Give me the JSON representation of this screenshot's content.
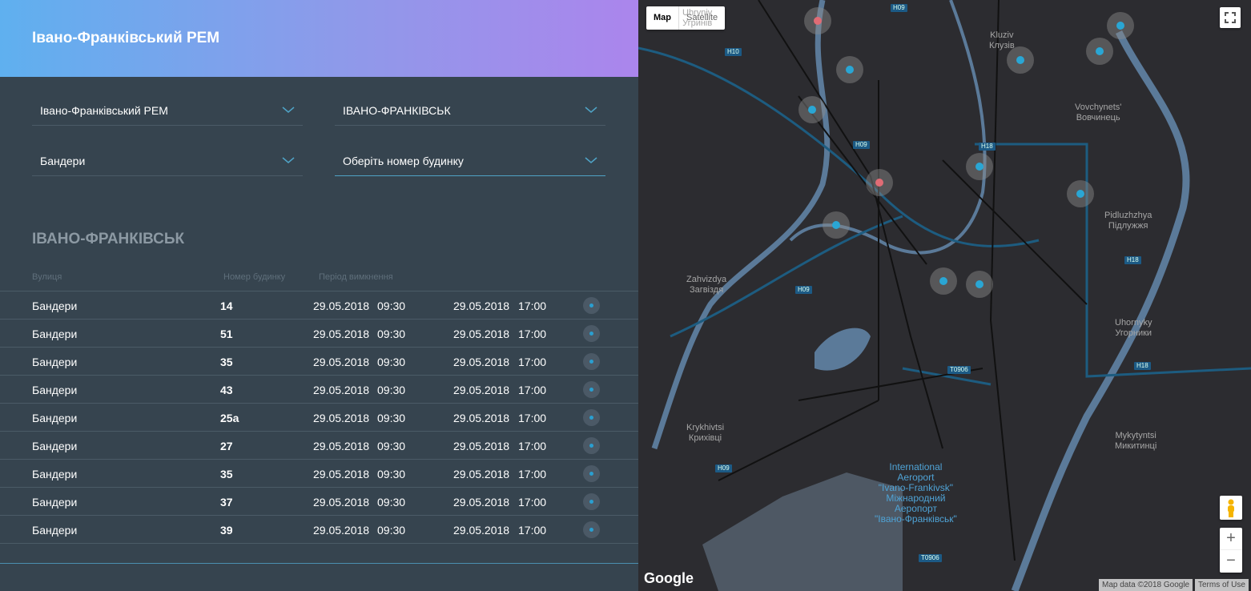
{
  "header": {
    "title": "Івано-Франківський РЕМ"
  },
  "filters": {
    "rem": "Івано-Франківський РЕМ",
    "city": "ІВАНО-ФРАНКІВСЬК",
    "street": "Бандери",
    "house_placeholder": "Оберіть номер будинку"
  },
  "results": {
    "city": "ІВАНО-ФРАНКІВСЬК",
    "columns": [
      "Вулиця",
      "Номер будинку",
      "Період вимкнення"
    ],
    "rows": [
      {
        "street": "Бандери",
        "house": "14",
        "start_date": "29.05.2018",
        "start_time": "09:30",
        "end_date": "29.05.2018",
        "end_time": "17:00"
      },
      {
        "street": "Бандери",
        "house": "51",
        "start_date": "29.05.2018",
        "start_time": "09:30",
        "end_date": "29.05.2018",
        "end_time": "17:00"
      },
      {
        "street": "Бандери",
        "house": "35",
        "start_date": "29.05.2018",
        "start_time": "09:30",
        "end_date": "29.05.2018",
        "end_time": "17:00"
      },
      {
        "street": "Бандери",
        "house": "43",
        "start_date": "29.05.2018",
        "start_time": "09:30",
        "end_date": "29.05.2018",
        "end_time": "17:00"
      },
      {
        "street": "Бандери",
        "house": "25а",
        "start_date": "29.05.2018",
        "start_time": "09:30",
        "end_date": "29.05.2018",
        "end_time": "17:00"
      },
      {
        "street": "Бандери",
        "house": "27",
        "start_date": "29.05.2018",
        "start_time": "09:30",
        "end_date": "29.05.2018",
        "end_time": "17:00"
      },
      {
        "street": "Бандери",
        "house": "35",
        "start_date": "29.05.2018",
        "start_time": "09:30",
        "end_date": "29.05.2018",
        "end_time": "17:00"
      },
      {
        "street": "Бандери",
        "house": "37",
        "start_date": "29.05.2018",
        "start_time": "09:30",
        "end_date": "29.05.2018",
        "end_time": "17:00"
      },
      {
        "street": "Бандери",
        "house": "39",
        "start_date": "29.05.2018",
        "start_time": "09:30",
        "end_date": "29.05.2018",
        "end_time": "17:00"
      }
    ]
  },
  "map": {
    "type_map": "Map",
    "type_satellite": "Satellite",
    "zoom_in": "+",
    "zoom_out": "−",
    "attribution": "Map data ©2018 Google",
    "terms": "Terms of Use",
    "logo": "Google",
    "places": [
      {
        "name": "Uhryniv\nУгринів"
      },
      {
        "name": "Kluziv\nКлузів"
      },
      {
        "name": "Vovchynets'\nВовчинець"
      },
      {
        "name": "Pidluzhzhya\nПідлужжя"
      },
      {
        "name": "Zahvizdya\nЗагвіздя"
      },
      {
        "name": "Uhornyky\nУгорники"
      },
      {
        "name": "Krykhivtsi\nКрихівці"
      },
      {
        "name": "Mykytyntsi\nМикитинці"
      },
      {
        "name": "International\nAeroport\n\"Ivano-Frankivsk\"\nМіжнародний\nАеропорт\n\"Івано-Франківськ\""
      }
    ],
    "roads": [
      "H09",
      "H10",
      "H09",
      "H18",
      "H18",
      "H09",
      "H18",
      "T0906",
      "H09",
      "T0906"
    ]
  }
}
